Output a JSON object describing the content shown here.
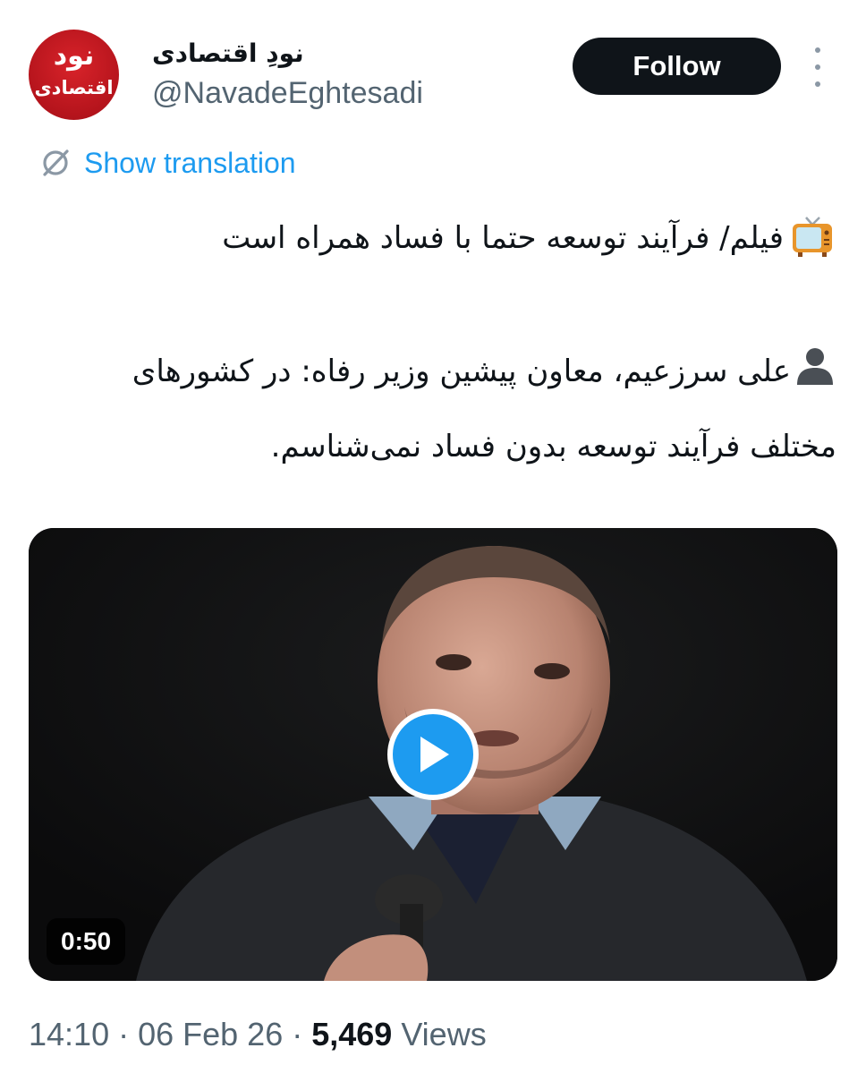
{
  "account": {
    "display_name": "نودِ اقتصادی",
    "handle": "@NavadeEghtesadi",
    "avatar_logo_top": "نود",
    "avatar_logo_bottom": "اقتصادی",
    "avatar_color": "#c4161c"
  },
  "actions": {
    "follow_label": "Follow",
    "more_icon": "more-vertical-icon",
    "translate_icon": "translate-globe-icon",
    "translate_label": "Show translation"
  },
  "tweet": {
    "line1": "فیلم/ فرآیند توسعه حتما با فساد همراه است",
    "line1_emoji": "television-emoji",
    "line2": "علی سرزعیم، معاون پیشین وزیر رفاه: در کشورهای",
    "line2_emoji": "person-silhouette-emoji",
    "line3": "مختلف فرآیند توسعه بدون فساد نمی‌شناسم."
  },
  "video": {
    "duration": "0:50",
    "play_icon": "play-icon"
  },
  "meta": {
    "time": "14:10",
    "sep1": " · ",
    "date": "06 Feb 26",
    "sep2": " · ",
    "views_count": "5,469",
    "views_label": " Views"
  },
  "colors": {
    "accent": "#1d9bf0",
    "text": "#0f1419",
    "secondary": "#536471",
    "button_bg": "#0f1419"
  }
}
